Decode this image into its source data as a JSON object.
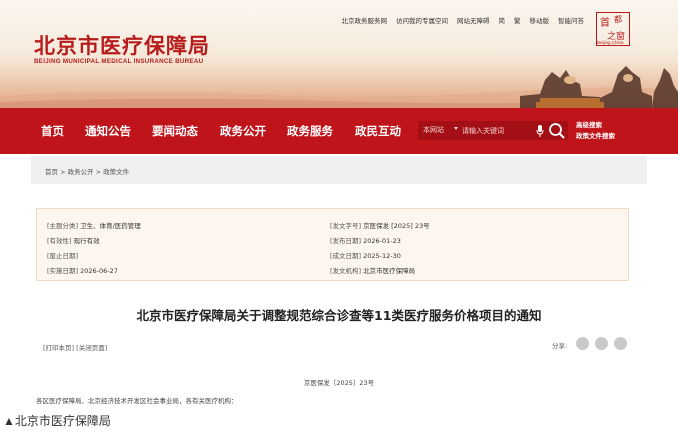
{
  "header": {
    "logo_cn": "北京市医疗保障局",
    "logo_en": "BEIJING MUNICIPAL MEDICAL INSURANCE BUREAU",
    "top_links": [
      "北京政务服务网",
      "访问我的专属空间",
      "网站无障碍",
      "简",
      "繁",
      "移动版",
      "智能问答"
    ],
    "seal": {
      "c1": "首",
      "c2": "都",
      "c3": "之窗",
      "en": "Beijing.China"
    }
  },
  "nav": {
    "items": [
      "首页",
      "通知公告",
      "要闻动态",
      "政务公开",
      "政务服务",
      "政民互动"
    ],
    "search_scope": "本网站",
    "search_placeholder": "请输入关键词",
    "advanced_search": "高级搜索",
    "policy_search": "政策文件搜索"
  },
  "breadcrumb": "首页 > 政务公开 > 政策文件",
  "meta": {
    "left": [
      {
        "key": "[主题分类]",
        "value": "卫生、体育/医药管理"
      },
      {
        "key": "[有效性]",
        "value": "现行有效"
      },
      {
        "key": "[废止日期]",
        "value": ""
      },
      {
        "key": "[实施日期]",
        "value": "2026-06-27"
      }
    ],
    "right": [
      {
        "key": "[发文字号]",
        "value": "京医保发 [2025] 23号"
      },
      {
        "key": "[发布日期]",
        "value": "2026-01-23"
      },
      {
        "key": "[成文日期]",
        "value": "2025-12-30"
      },
      {
        "key": "[发文机构]",
        "value": "北京市医疗保障局"
      }
    ]
  },
  "article": {
    "title": "北京市医疗保障局关于调整规范综合诊查等11类医疗服务价格项目的通知",
    "print": "[打印本页]",
    "close": "[关闭页面]",
    "share_label": "分享:",
    "doc_number": "京医保发〔2025〕23号",
    "recipients": "各区医疗保障局、北京经济技术开发区社会事业局，各有关医疗机构："
  },
  "credit": "▲北京市医疗保障局"
}
